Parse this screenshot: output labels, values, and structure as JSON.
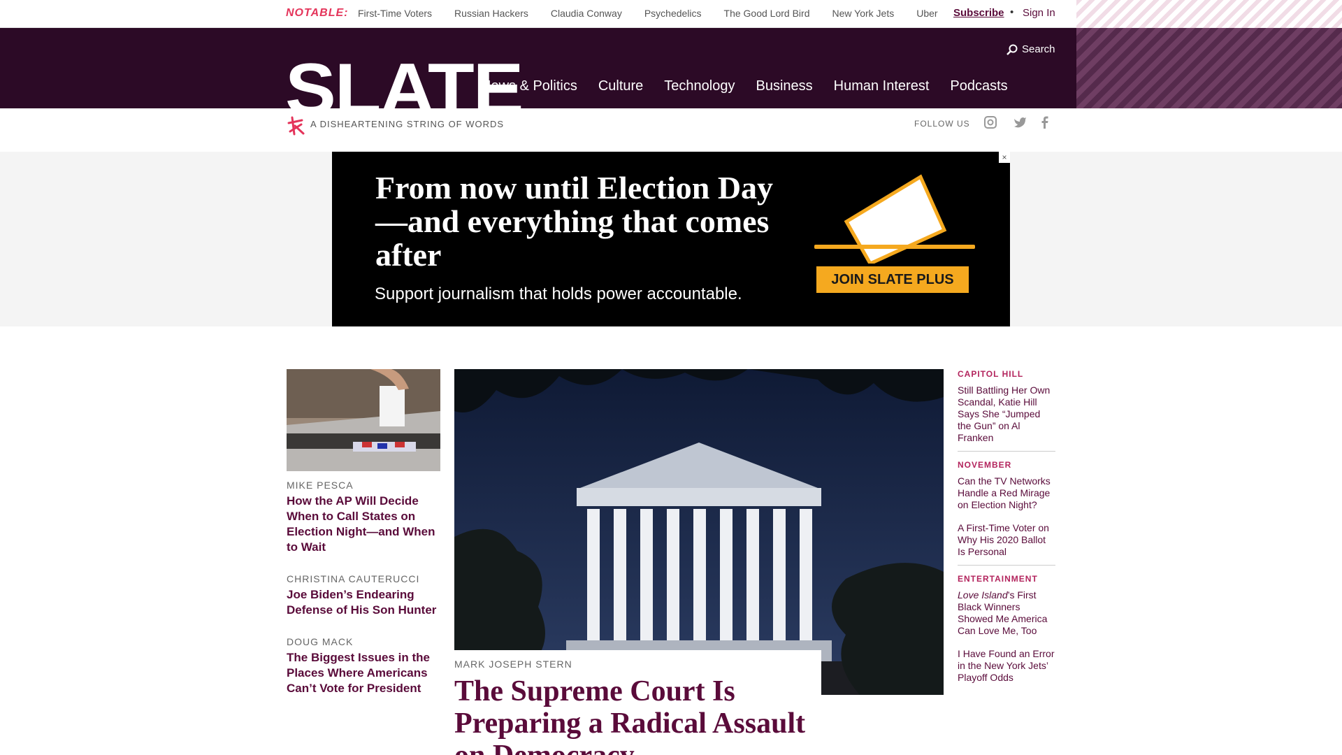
{
  "topbar": {
    "notable": "NOTABLE:",
    "links": [
      "First-Time Voters",
      "Russian Hackers",
      "Claudia Conway",
      "Psychedelics",
      "The Good Lord Bird",
      "New York Jets",
      "Uber"
    ],
    "subscribe": "Subscribe",
    "separator": "•",
    "sign_in": "Sign In"
  },
  "header": {
    "logo": "SLATE",
    "nav": [
      "News & Politics",
      "Culture",
      "Technology",
      "Business",
      "Human Interest",
      "Podcasts"
    ],
    "search": "Search"
  },
  "tagrow": {
    "tagline": "A DISHEARTENING STRING OF WORDS",
    "follow": "FOLLOW US"
  },
  "ad": {
    "headline": "From now until Election Day—and everything that comes after",
    "subline": "Support journalism that holds power accountable.",
    "button": "JOIN SLATE PLUS",
    "close": "×"
  },
  "left_stories": [
    {
      "byline": "Mike Pesca",
      "headline": "How the AP Will Decide When to Call States on Election Night—and When to Wait"
    },
    {
      "byline": "Christina Cauterucci",
      "headline": "Joe Biden’s Endearing Defense of His Son Hunter"
    },
    {
      "byline": "Doug Mack",
      "headline": "The Biggest Issues in the Places Where Americans Can’t Vote for President"
    }
  ],
  "hero": {
    "byline": "MARK JOSEPH STERN",
    "headline": "The Supreme Court Is Preparing a Radical Assault on Democracy"
  },
  "right_rail": {
    "s1": {
      "section": "CAPITOL HILL",
      "items": [
        "Still Battling Her Own Scandal, Katie Hill Says She “Jumped the Gun” on Al Franken"
      ]
    },
    "s2": {
      "section": "NOVEMBER",
      "items": [
        "Can the TV Networks Handle a Red Mirage on Election Night?",
        "A First-Time Voter on Why His 2020 Ballot Is Personal"
      ]
    },
    "s3": {
      "section": "ENTERTAINMENT",
      "title_italic": "Love Island",
      "item1_rest": "’s First Black Winners Showed Me America Can Love Me, Too",
      "items": [
        "I Have Found an Error in the New York Jets’ Playoff Odds"
      ]
    }
  }
}
